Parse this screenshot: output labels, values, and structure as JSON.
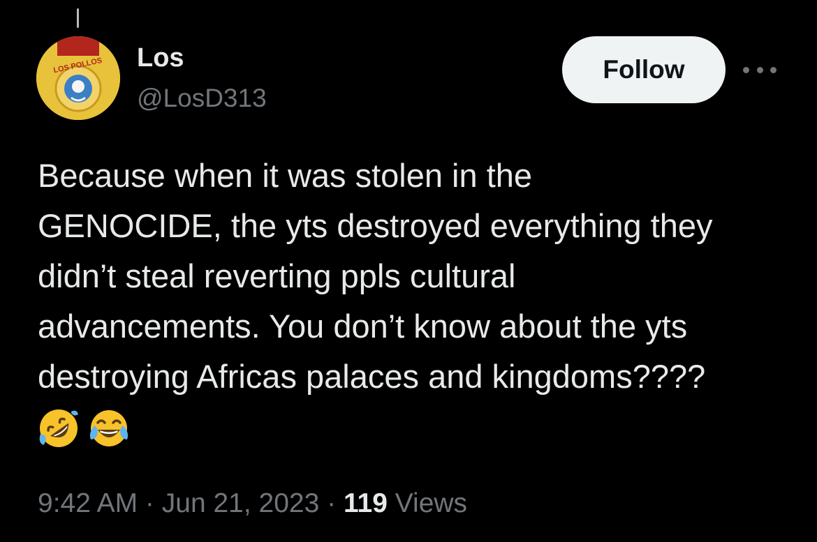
{
  "author": {
    "display_name": "Los",
    "handle": "@LosD313"
  },
  "follow_label": "Follow",
  "avatar_text": "LOS POLLOS",
  "tweet": {
    "text": "Because when it was stolen in the\nGENOCIDE, the yts destroyed everything they\ndidn’t steal reverting ppls cultural\nadvancements. You don’t know about the yts\ndestroying Africas palaces and kingdoms????",
    "emojis": [
      "rolling-on-floor-laughing",
      "face-with-tears-of-joy"
    ]
  },
  "meta": {
    "time": "9:42 AM",
    "separator": " · ",
    "date": "Jun 21, 2023",
    "views_count": "119",
    "views_label": " Views"
  },
  "colors": {
    "background": "#000000",
    "text_primary": "#e7e9ea",
    "text_secondary": "#71767b",
    "follow_bg": "#eff3f4"
  }
}
